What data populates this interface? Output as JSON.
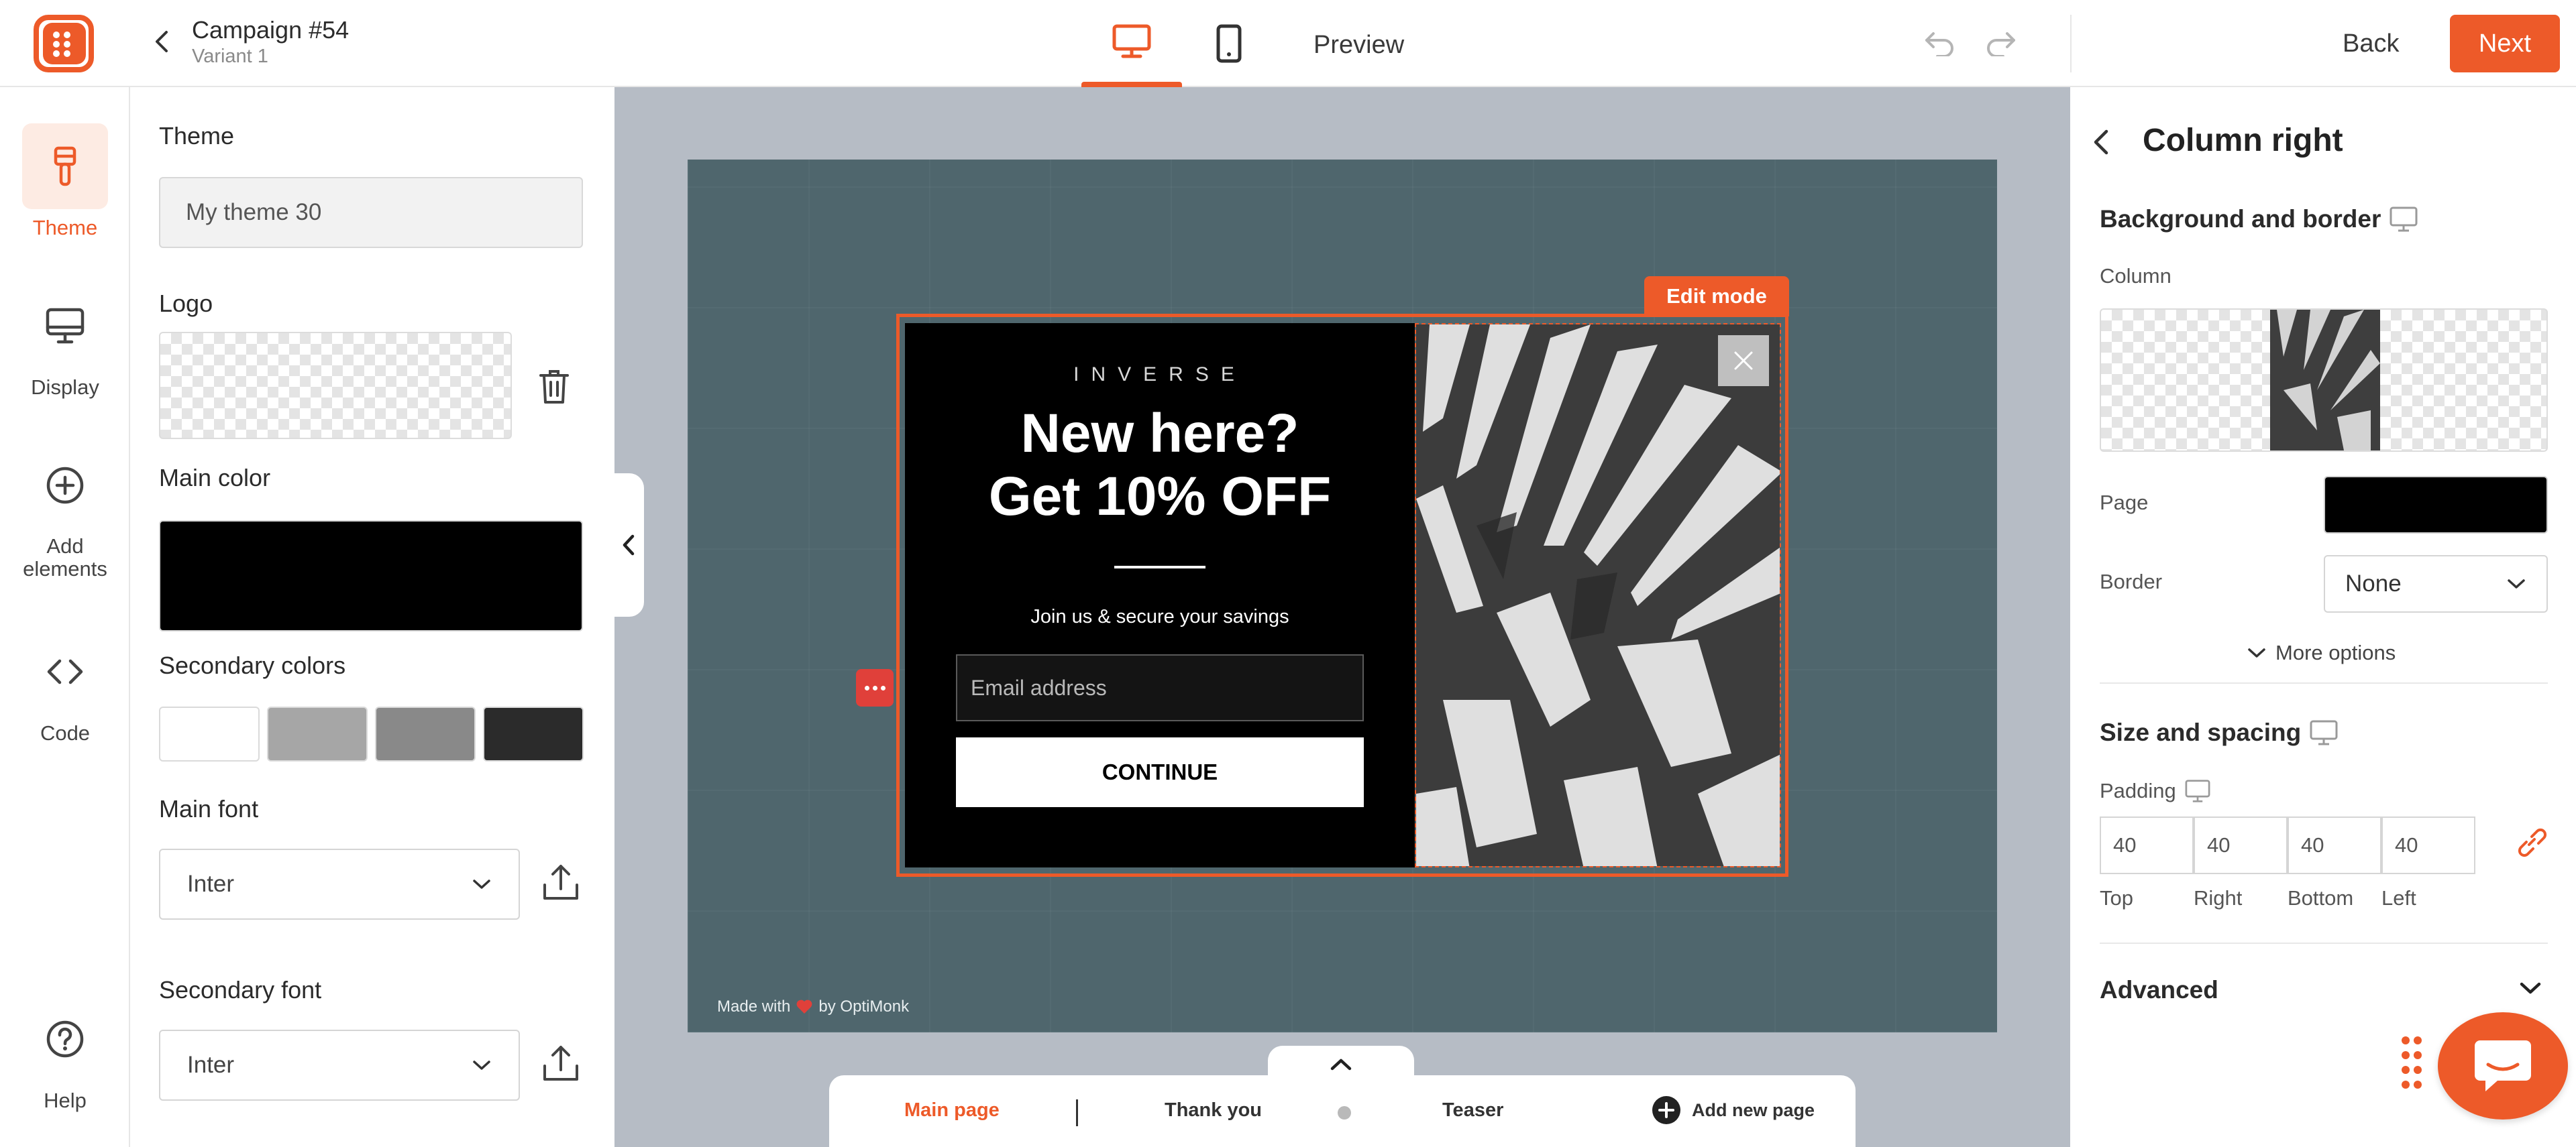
{
  "header": {
    "campaign_title": "Campaign #54",
    "campaign_subtitle": "Variant 1",
    "preview_label": "Preview",
    "back_label": "Back",
    "next_label": "Next"
  },
  "rail": {
    "items": [
      {
        "label": "Theme",
        "icon": "paintbrush-icon",
        "active": true
      },
      {
        "label": "Display",
        "icon": "monitor-icon",
        "active": false
      },
      {
        "label": "Add elements",
        "icon": "plus-circle-icon",
        "active": false
      },
      {
        "label": "Code",
        "icon": "code-icon",
        "active": false
      }
    ],
    "help_label": "Help"
  },
  "theme_panel": {
    "theme_label": "Theme",
    "theme_value": "My theme 30",
    "logo_label": "Logo",
    "main_color_label": "Main color",
    "main_color": "#000000",
    "secondary_colors_label": "Secondary colors",
    "secondary_colors": [
      "#ffffff",
      "#a6a6a6",
      "#898989",
      "#2b2b2b"
    ],
    "main_font_label": "Main font",
    "main_font": "Inter",
    "secondary_font_label": "Secondary font",
    "secondary_font": "Inter"
  },
  "canvas": {
    "edit_mode_label": "Edit mode",
    "made_with_prefix": "Made with",
    "made_with_suffix": "by OptiMonk",
    "popup": {
      "brand": "INVERSE",
      "headline_line1": "New here?",
      "headline_line2": "Get 10% OFF",
      "subtext": "Join us & secure your savings",
      "email_placeholder": "Email address",
      "cta_label": "CONTINUE"
    }
  },
  "page_tabs": {
    "tabs": [
      "Main page",
      "Thank you",
      "Teaser"
    ],
    "active": "Main page",
    "add_label": "Add new page"
  },
  "right_panel": {
    "title": "Column right",
    "background_border_heading": "Background and border",
    "column_label": "Column",
    "page_label": "Page",
    "page_color": "#000000",
    "border_label": "Border",
    "border_value": "None",
    "more_options_label": "More options",
    "size_spacing_heading": "Size and spacing",
    "padding_label": "Padding",
    "padding": {
      "top": "40",
      "right": "40",
      "bottom": "40",
      "left": "40"
    },
    "padding_labels": {
      "top": "Top",
      "right": "Right",
      "bottom": "Bottom",
      "left": "Left"
    },
    "advanced_label": "Advanced"
  },
  "colors": {
    "accent": "#ed5a29",
    "canvas_bg": "#b6bcc5",
    "stage_bg": "#4f666d"
  }
}
